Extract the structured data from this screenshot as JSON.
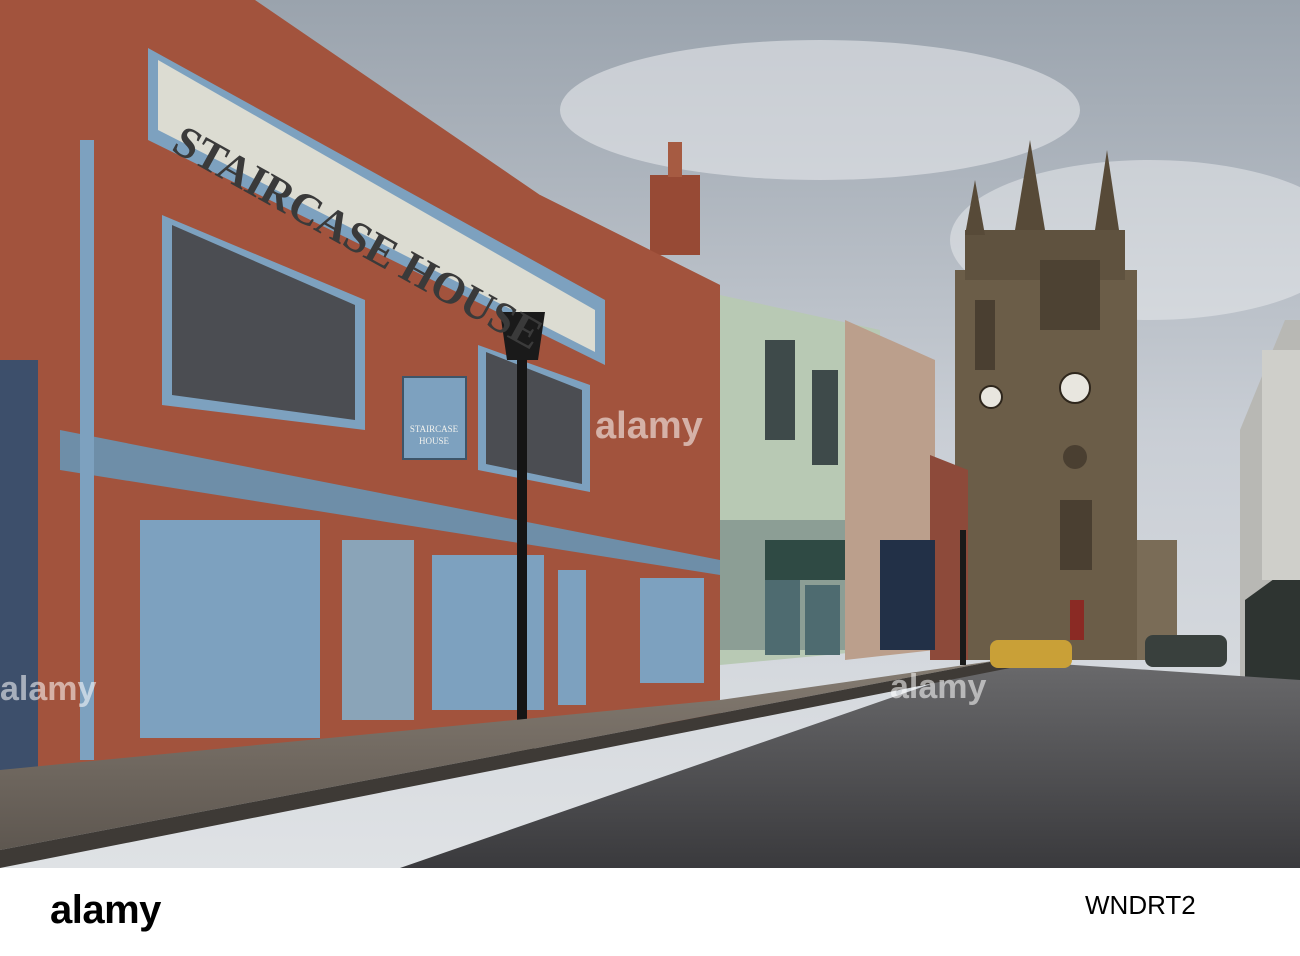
{
  "photo": {
    "sign_fascia": "STAIRCASE HOUSE",
    "hanging_sign_line1": "STAIRCASE",
    "hanging_sign_line2": "HOUSE"
  },
  "watermark": {
    "text": "alamy"
  },
  "footer": {
    "logo": "alamy",
    "image_id": "WNDRT2"
  },
  "colors": {
    "brick": "#a2533d",
    "shutter_blue": "#7da1bf",
    "sky": "#c9ced5",
    "stone_tower": "#6b5d48",
    "cobbles": "#4a4a4d"
  }
}
